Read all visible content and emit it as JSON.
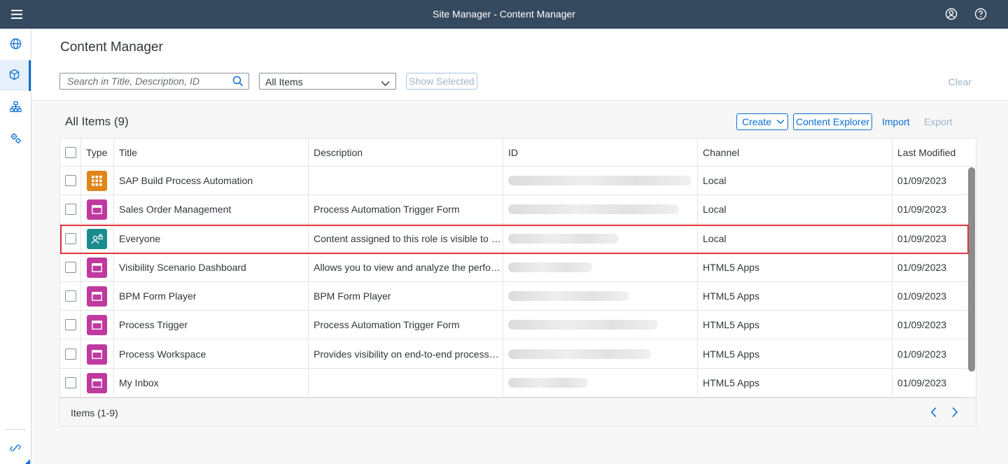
{
  "shell": {
    "title": "Site Manager - Content Manager"
  },
  "header": {
    "title": "Content Manager",
    "search_placeholder": "Search in Title, Description, ID",
    "filter_value": "All Items",
    "show_selected_label": "Show Selected",
    "clear_label": "Clear"
  },
  "table": {
    "title": "All Items (9)",
    "create_label": "Create",
    "content_explorer_label": "Content Explorer",
    "import_label": "Import",
    "export_label": "Export",
    "columns": {
      "type": "Type",
      "title": "Title",
      "description": "Description",
      "id": "ID",
      "channel": "Channel",
      "last_modified": "Last Modified"
    },
    "rows": [
      {
        "icon": "launchpad-icon",
        "color": "#e0851a",
        "title": "SAP Build Process Automation",
        "description": "",
        "channel": "Local",
        "last_modified": "01/09/2023"
      },
      {
        "icon": "app-window-icon",
        "color": "#c0399f",
        "title": "Sales Order Management",
        "description": "Process Automation Trigger Form",
        "channel": "Local",
        "last_modified": "01/09/2023"
      },
      {
        "icon": "role-icon",
        "color": "#1b8c8e",
        "title": "Everyone",
        "description": "Content assigned to this role is visible to all…",
        "channel": "Local",
        "last_modified": "01/09/2023"
      },
      {
        "icon": "app-window-icon",
        "color": "#c0399f",
        "title": "Visibility Scenario Dashboard",
        "description": "Allows you to view and analyze the perfor…",
        "channel": "HTML5 Apps",
        "last_modified": "01/09/2023"
      },
      {
        "icon": "app-window-icon",
        "color": "#c0399f",
        "title": "BPM Form Player",
        "description": "BPM Form Player",
        "channel": "HTML5 Apps",
        "last_modified": "01/09/2023"
      },
      {
        "icon": "app-window-icon",
        "color": "#c0399f",
        "title": "Process Trigger",
        "description": "Process Automation Trigger Form",
        "channel": "HTML5 Apps",
        "last_modified": "01/09/2023"
      },
      {
        "icon": "app-window-icon",
        "color": "#c0399f",
        "title": "Process Workspace",
        "description": "Provides visibility on end-to-end processes …",
        "channel": "HTML5 Apps",
        "last_modified": "01/09/2023"
      },
      {
        "icon": "app-window-icon",
        "color": "#c0399f",
        "title": "My Inbox",
        "description": "",
        "channel": "HTML5 Apps",
        "last_modified": "01/09/2023"
      }
    ],
    "footer_count": "Items (1-9)"
  },
  "colors": {
    "shell": "#354a5f",
    "accent": "#0a6ed1",
    "highlight": "#e0353b"
  }
}
